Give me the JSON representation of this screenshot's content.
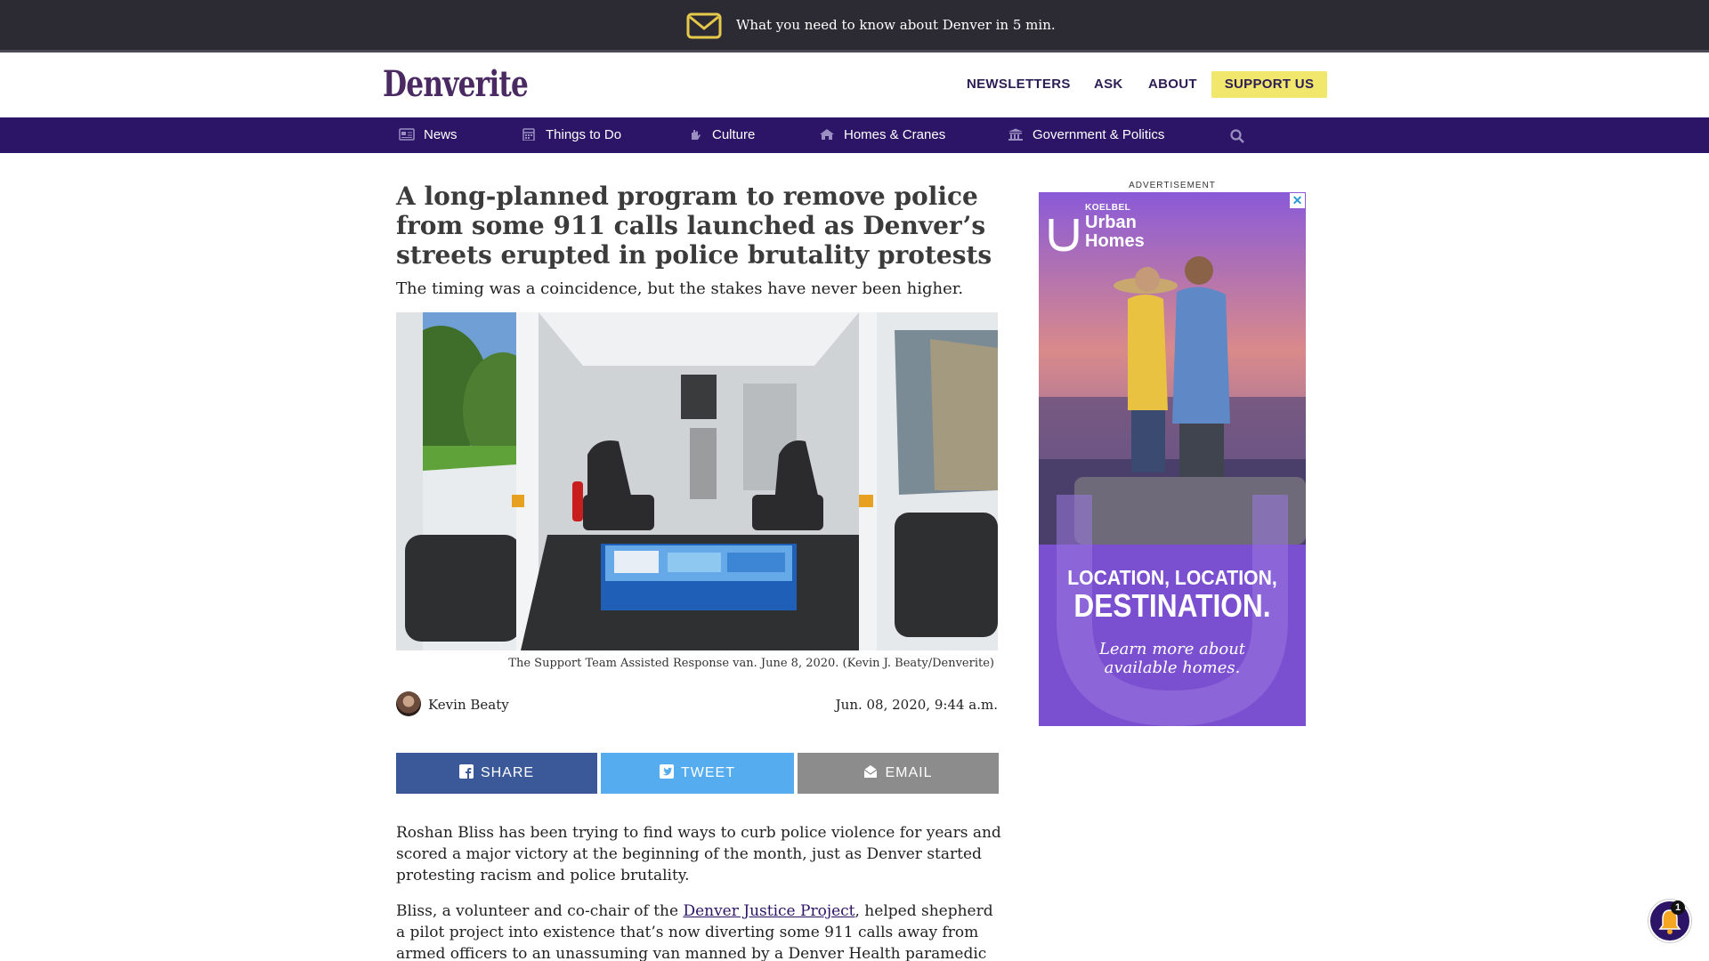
{
  "topbar": {
    "promo_text": "What you need to know about Denver in 5 min.",
    "icon": "envelope-icon"
  },
  "header": {
    "logo_text": "Denverite",
    "nav": {
      "newsletters": "NEWSLETTERS",
      "ask": "ASK",
      "about": "ABOUT",
      "support": "SUPPORT US"
    }
  },
  "categories": [
    {
      "label": "News",
      "icon": "newspaper-icon"
    },
    {
      "label": "Things to Do",
      "icon": "calendar-icon"
    },
    {
      "label": "Culture",
      "icon": "hand-icon"
    },
    {
      "label": "Homes & Cranes",
      "icon": "house-icon"
    },
    {
      "label": "Government & Politics",
      "icon": "capitol-building-icon"
    }
  ],
  "article": {
    "headline": "A long-planned program to remove police from some 911 calls launched as Denver’s streets erupted in police brutality protests",
    "dek": "The timing was a coincidence, but the stakes have never been higher.",
    "caption": "The Support Team Assisted Response van. June 8, 2020. (Kevin J. Beaty/Denverite)",
    "author": "Kevin Beaty",
    "date": "Jun. 08, 2020, 9:44 a.m.",
    "share": {
      "facebook": "SHARE",
      "twitter": "TWEET",
      "email": "EMAIL"
    },
    "paragraph1": "Roshan Bliss has been trying to find ways to curb police violence for years and scored a major victory at the beginning of the month, just as Denver started protesting racism and police brutality.",
    "paragraph2_before": "Bliss, a volunteer and co-chair of the ",
    "paragraph2_link": "Denver Justice Project",
    "paragraph2_after": ", helped shepherd a pilot project into existence that’s now diverting some 911 calls away from armed officers to an unassuming van manned by a Denver Health paramedic and a social worker"
  },
  "ad": {
    "label": "ADVERTISEMENT",
    "close": "✕",
    "brand_small": "KOELBEL",
    "brand_line1": "Urban",
    "brand_line2": "Homes",
    "headline1": "LOCATION, LOCATION,",
    "headline2": "DESTINATION.",
    "sub1": "Learn more about",
    "sub2": "available homes."
  },
  "notification": {
    "badge_count": "1"
  },
  "colors": {
    "brand_purple": "#2c1466",
    "logo_purple": "#4b2a63",
    "support_yellow": "#f2e76d",
    "facebook_blue": "#3b5998",
    "twitter_blue": "#55acee",
    "email_gray": "#8c8c8c"
  }
}
